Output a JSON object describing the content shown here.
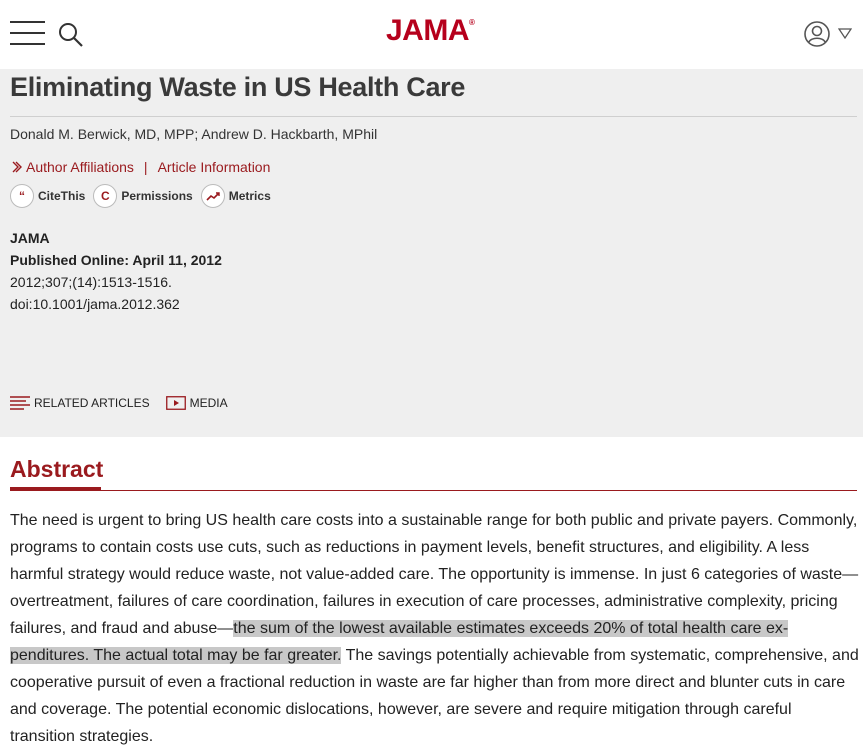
{
  "header": {
    "logo": "JAMA",
    "logo_mark": "®",
    "icons": [
      "hamburger-menu-icon",
      "search-icon",
      "user-icon",
      "caret-down-icon"
    ]
  },
  "article": {
    "title": "Eliminating Waste in US Health Care",
    "authors": "Donald M. Berwick, MD, MPP; Andrew D. Hackbarth, MPhil",
    "affiliations_link": "Author Affiliations",
    "separator": "|",
    "article_info_link": "Article Information",
    "tools": {
      "cite_icon": "“",
      "cite_label": "CiteThis",
      "permissions_icon": "C",
      "permissions_label": "Permissions",
      "metrics_label": "Metrics"
    },
    "journal": "JAMA",
    "published": "Published Online: April 11, 2012",
    "citation": "2012;307;(14):1513-1516.",
    "doi": "doi:10.1001/jama.2012.362",
    "related_articles": "RELATED ARTICLES",
    "media": "MEDIA"
  },
  "abstract": {
    "heading": "Abstract",
    "text_before": "The need is urgent to bring US health care costs into a sustainable range for both public and private payers. Commonly, programs to contain costs use cuts, such as reductions in payment levels, benefit structures, and eligibility. A less harmful strategy would reduce waste, not value-added care. The opportunity is immense. In just 6 categories of waste—overtreatment, failures of care coordination, failures in execution of care processes, administrative complexity, pricing failures, and fraud and abuse—",
    "text_highlighted": "the sum of the lowest available estimates exceeds 20% of total health care ex­penditures. The actual total may be far greater.",
    "text_after": " The savings potentially achievable from systematic, comprehensive, and cooperative pursuit of even a fractional reduction in waste are far higher than from more direct and blunter cuts in care and coverage. The potential economic dislocations, however, are severe and require mitigation through careful transition strategies."
  },
  "colors": {
    "brand": "#b6001c",
    "link": "#9a1a1e",
    "panel_bg": "#efefef",
    "highlight": "#c8c8c8"
  }
}
